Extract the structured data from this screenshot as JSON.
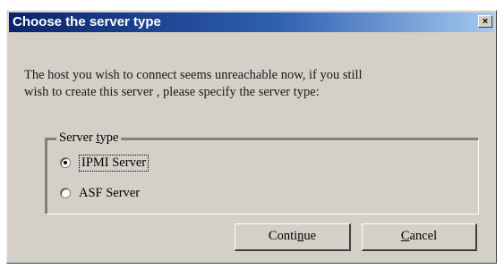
{
  "window": {
    "title": "Choose the server type",
    "close_glyph": "×"
  },
  "message": {
    "line1": "The host you wish to connect seems unreachable now, if you still",
    "line2": "wish to create this server , please specify the server type:"
  },
  "server_type_group": {
    "legend_pre": "Server ",
    "legend_mnemonic": "t",
    "legend_post": "ype",
    "options": [
      {
        "label": "IPMI Server",
        "selected": true,
        "focused": true
      },
      {
        "label": "ASF Server",
        "selected": false,
        "focused": false
      }
    ]
  },
  "buttons": {
    "continue_pre": "Conti",
    "continue_mnemonic": "n",
    "continue_post": "ue",
    "cancel_mnemonic": "C",
    "cancel_post": "ancel"
  },
  "colors": {
    "title_gradient_start": "#0a246a",
    "title_gradient_end": "#a6caf0",
    "dialog_face": "#d4d0c8"
  }
}
